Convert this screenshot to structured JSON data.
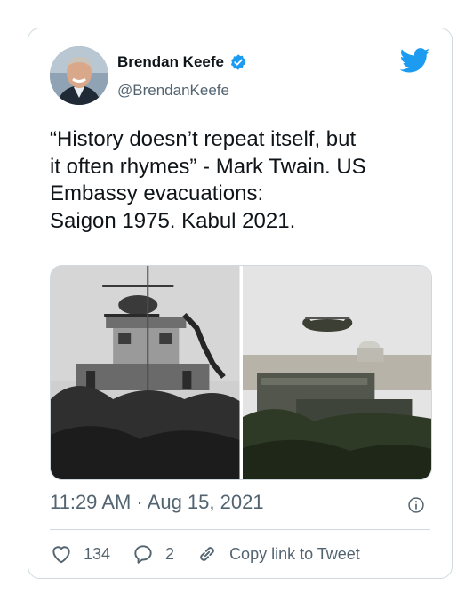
{
  "author": {
    "name": "Brendan Keefe",
    "handle": "@BrendanKeefe"
  },
  "icons": {
    "verified": "verified-badge-icon",
    "logo": "twitter-bird-icon",
    "info": "info-icon",
    "like": "heart-icon",
    "reply": "speech-bubble-icon",
    "link": "link-icon"
  },
  "tweet": {
    "text": "“History doesn’t repeat itself, but\nit often rhymes” - Mark Twain. US\nEmbassy evacuations:\nSaigon 1975. Kabul 2021."
  },
  "meta": {
    "timestamp": "11:29 AM · Aug 15, 2021"
  },
  "actions": {
    "likes": "134",
    "replies": "2",
    "copy_link": "Copy link to Tweet"
  },
  "colors": {
    "accent": "#1d9bf0",
    "secondary_text": "#536471",
    "border": "#cfd9de"
  }
}
